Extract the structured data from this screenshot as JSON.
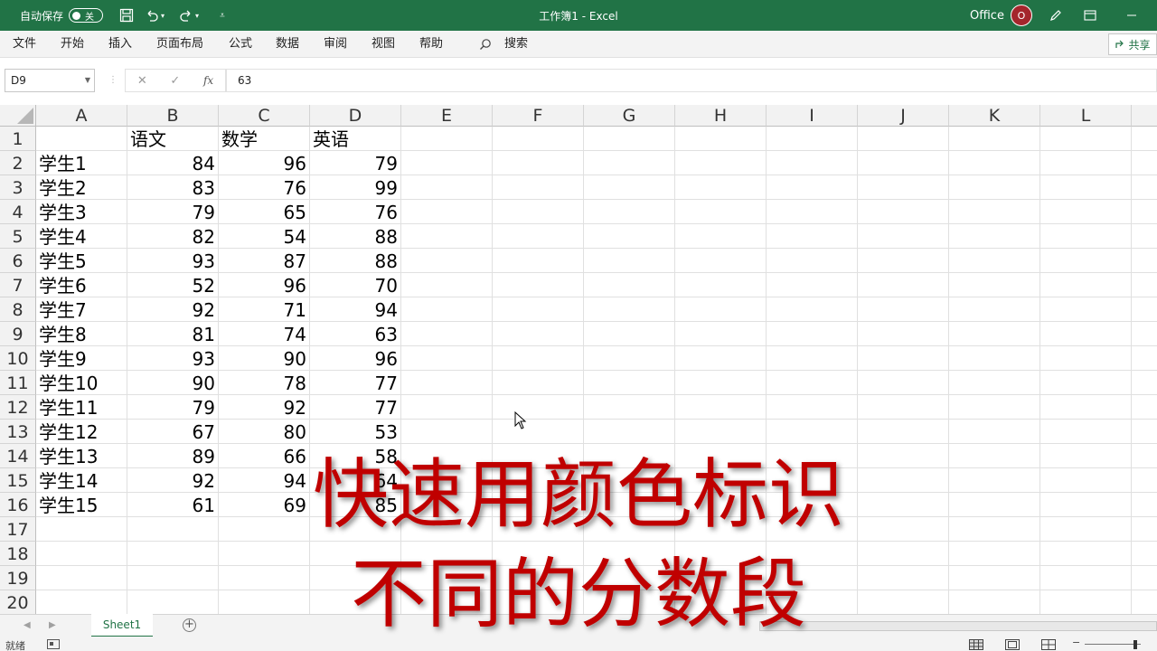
{
  "titlebar": {
    "autosave_label": "自动保存",
    "autosave_state": "关",
    "doc_title": "工作簿1  -  Excel",
    "account_label": "Office",
    "avatar_initial": "O",
    "color": "#217346"
  },
  "menu": {
    "items": [
      "文件",
      "开始",
      "插入",
      "页面布局",
      "公式",
      "数据",
      "审阅",
      "视图",
      "帮助"
    ],
    "search_label": "搜索",
    "share_label": "共享"
  },
  "formula_bar": {
    "name_box": "D9",
    "formula_value": "63",
    "fx_label": "fx"
  },
  "sheet": {
    "columns": [
      "A",
      "B",
      "C",
      "D",
      "E",
      "F",
      "G",
      "H",
      "I",
      "J",
      "K",
      "L"
    ],
    "row_numbers": [
      "1",
      "2",
      "3",
      "4",
      "5",
      "6",
      "7",
      "8",
      "9",
      "10",
      "11",
      "12",
      "13",
      "14",
      "15",
      "16",
      "17",
      "18",
      "19",
      "20"
    ],
    "header_row": [
      "",
      "语文",
      "数学",
      "英语"
    ],
    "rows": [
      [
        "学生1",
        "84",
        "96",
        "79"
      ],
      [
        "学生2",
        "83",
        "76",
        "99"
      ],
      [
        "学生3",
        "79",
        "65",
        "76"
      ],
      [
        "学生4",
        "82",
        "54",
        "88"
      ],
      [
        "学生5",
        "93",
        "87",
        "88"
      ],
      [
        "学生6",
        "52",
        "96",
        "70"
      ],
      [
        "学生7",
        "92",
        "71",
        "94"
      ],
      [
        "学生8",
        "81",
        "74",
        "63"
      ],
      [
        "学生9",
        "93",
        "90",
        "96"
      ],
      [
        "学生10",
        "90",
        "78",
        "77"
      ],
      [
        "学生11",
        "79",
        "92",
        "77"
      ],
      [
        "学生12",
        "67",
        "80",
        "53"
      ],
      [
        "学生13",
        "89",
        "66",
        "58"
      ],
      [
        "学生14",
        "92",
        "94",
        "64"
      ],
      [
        "学生15",
        "61",
        "69",
        "85"
      ]
    ]
  },
  "tabs": {
    "sheet_name": "Sheet1",
    "add_label": "+"
  },
  "statusbar": {
    "ready_label": "就绪"
  },
  "overlay": {
    "line1": "快速用颜色标识",
    "line2": "不同的分数段",
    "color": "#c00000"
  }
}
